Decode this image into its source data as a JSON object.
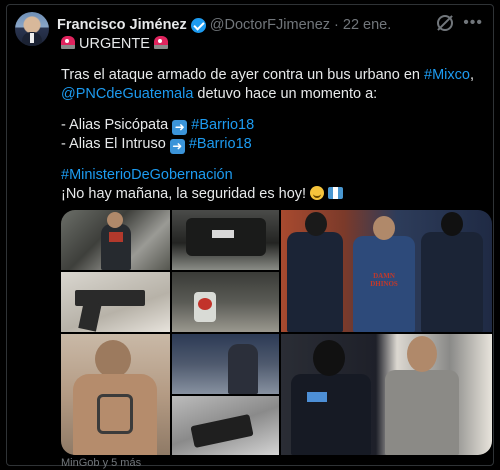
{
  "author": {
    "name": "Francisco Jiménez",
    "handle": "@DoctorFJimenez",
    "separator": "·",
    "date": "22 ene."
  },
  "tweet": {
    "urgent_label": "URGENTE",
    "line1_prefix": "Tras el ataque armado de ayer contra un bus urbano en ",
    "line1_link": "#Mixco",
    "line1_suffix": ",",
    "line2_link": "@PNCdeGuatemala",
    "line2_suffix": " detuvo hace un momento a:",
    "alias1_prefix": "- Alias Psicópata ",
    "alias1_link": "#Barrio18",
    "alias2_prefix": "- Alias El Intruso ",
    "alias2_link": "#Barrio18",
    "hashtag_ministry": "#MinisterioDeGobernación",
    "closing": "¡No hay mañana, la seguridad es hoy! "
  },
  "icons": {
    "urgent_emoji": "police-light-icon",
    "arrow_emoji": "right-arrow-icon",
    "face_emoji": "smiling-face-icon",
    "flag_emoji": "guatemala-flag-icon",
    "header_action": "grok-icon",
    "more": "more-options-icon"
  },
  "media_photos": [
    "photo-vehicle-suspect",
    "photo-car-rear",
    "photo-pistol",
    "photo-car-interior",
    "photo-police-detainee-1",
    "photo-tattooed-man",
    "photo-bus-scene",
    "photo-weapon-closeup",
    "photo-police-detainee-2"
  ],
  "photo_text": {
    "shirt_text": "DAMN DHINOS"
  },
  "footer": {
    "attribution": "MinGob y 5 más"
  },
  "colors": {
    "link": "#1d9bf0",
    "verified": "#1d9bf0",
    "muted": "#71767b",
    "text": "#e7e9ea",
    "background": "#000000"
  }
}
